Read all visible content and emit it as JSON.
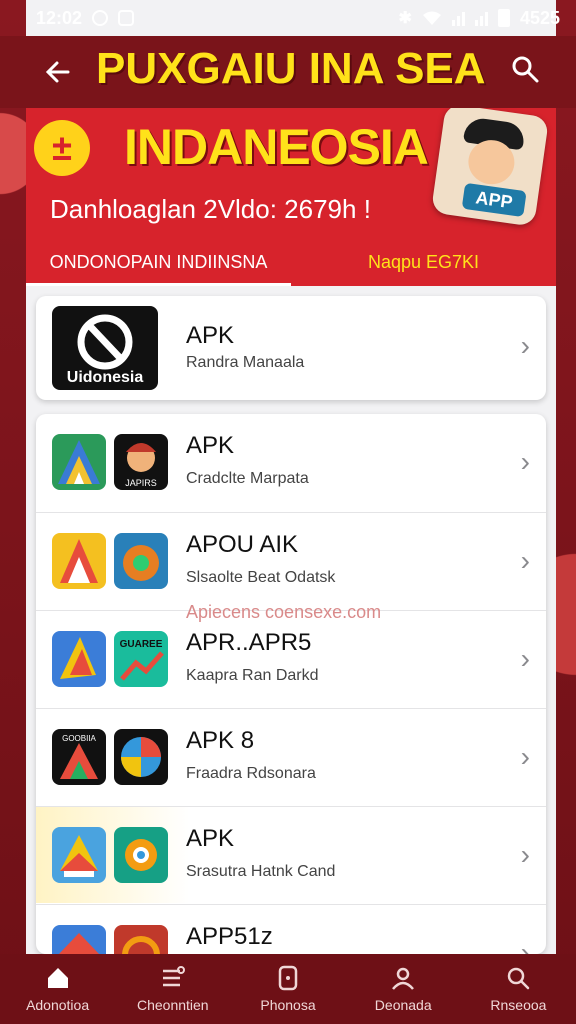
{
  "status": {
    "time": "12:02",
    "time_right": "4525"
  },
  "header": {
    "title": "PUXGAIU INA SEA"
  },
  "banner": {
    "logo": "±",
    "title": "INDANEOSIA",
    "subtitle": "Danhloaglan 2Vldo: 2679h !",
    "mascot_tag": "APP",
    "tabs": [
      {
        "label": "ONDONOPAIN INDIINSNA",
        "active": true
      },
      {
        "label": "Naqpu EG7KI",
        "active": false
      }
    ]
  },
  "featured": {
    "title": "APK",
    "subtitle": "Randra Manaala",
    "logo_text": "Uidonesia"
  },
  "list": [
    {
      "title": "APK",
      "subtitle": "Cradclte Marpata",
      "icon_b_text": "JAPIRS"
    },
    {
      "title": "APOU AIK",
      "subtitle": "Slsaolte Beat Odatsk"
    },
    {
      "title": "APR..APR5",
      "subtitle": "Kaapra Ran Darkd",
      "icon_b_text": "GUAREE"
    },
    {
      "title": "APK 8",
      "subtitle": "Fraadra Rdsonara",
      "icon_b_text": "GOOBIIA"
    },
    {
      "title": "APK",
      "subtitle": "Srasutra Hatnk Cand"
    },
    {
      "title": "APP51z",
      "subtitle": ""
    }
  ],
  "watermark": "Apiecens coensexe.com",
  "nav": [
    {
      "label": "Adonotioa"
    },
    {
      "label": "Cheonntien"
    },
    {
      "label": "Phonosa"
    },
    {
      "label": "Deonada"
    },
    {
      "label": "Rnseooa"
    }
  ],
  "colors": {
    "accent": "#d7232c",
    "yellow": "#ffe21a",
    "dark": "#7a141a"
  }
}
